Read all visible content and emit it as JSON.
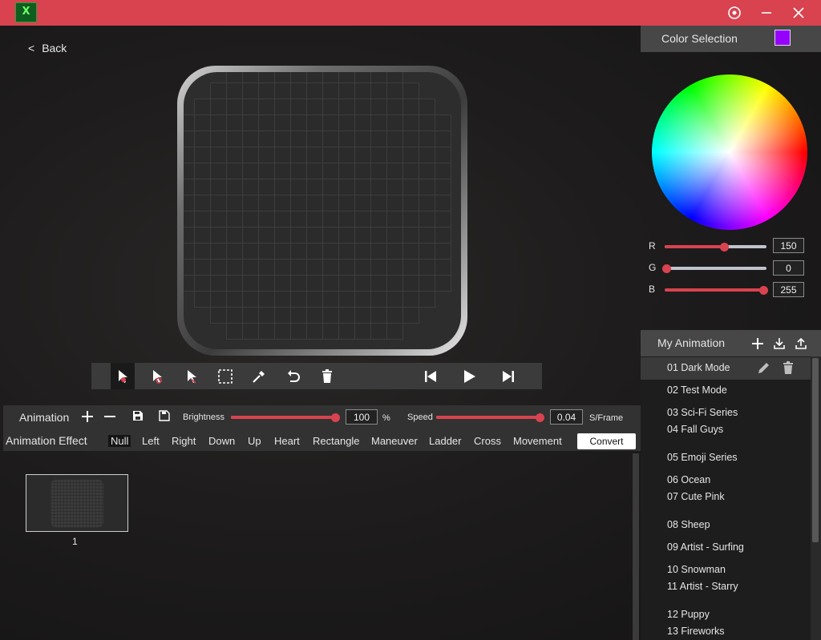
{
  "titlebar": {
    "logo_text": "X",
    "settings_icon": "gear-icon",
    "minimize_icon": "minimize-icon",
    "close_icon": "close-icon"
  },
  "nav": {
    "back_label": "Back",
    "back_glyph": "<"
  },
  "toolbar": {
    "icons": [
      "select-cursor-icon",
      "select-add-icon",
      "select-remove-icon",
      "marquee-select-icon",
      "eyedropper-icon",
      "undo-icon",
      "trash-icon",
      "skip-back-icon",
      "play-icon",
      "skip-forward-icon"
    ]
  },
  "animation_bar": {
    "label": "Animation",
    "brightness_label": "Brightness",
    "brightness_value": "100",
    "brightness_unit": "%",
    "brightness_level": 1.0,
    "speed_label": "Speed",
    "speed_value": "0.04",
    "speed_unit": "S/Frame",
    "speed_level": 1.0
  },
  "effects": {
    "label": "Animation Effect",
    "items": [
      "Null",
      "Left",
      "Right",
      "Down",
      "Up",
      "Heart",
      "Rectangle",
      "Maneuver",
      "Ladder",
      "Cross",
      "Movement"
    ],
    "selected": "Null",
    "convert_label": "Convert"
  },
  "frames": [
    {
      "number": "1"
    }
  ],
  "color_selection": {
    "title": "Color Selection",
    "swatch_color": "#9600ff",
    "r_label": "R",
    "r_value": "150",
    "g_label": "G",
    "g_value": "0",
    "b_label": "B",
    "b_value": "255"
  },
  "my_animation": {
    "title": "My Animation",
    "items": [
      "01 Dark Mode",
      "02 Test Mode",
      "03 Sci-Fi Series",
      "04 Fall Guys",
      "05 Emoji Series",
      "06 Ocean",
      "07 Cute Pink",
      "08 Sheep",
      "09 Artist - Surfing",
      "10 Snowman",
      "11 Artist - Starry",
      "12 Puppy",
      "13 Fireworks"
    ],
    "selected_index": 0
  },
  "colors": {
    "accent": "#d8434f",
    "panel": "#474747"
  }
}
